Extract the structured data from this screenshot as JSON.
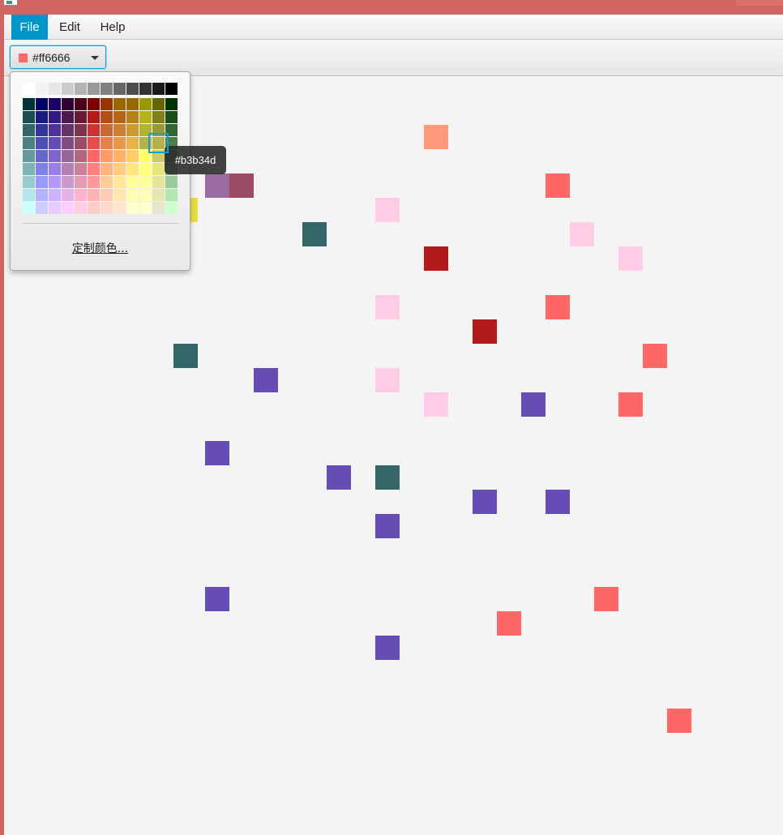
{
  "menubar": {
    "items": [
      {
        "label": "File",
        "active": true
      },
      {
        "label": "Edit",
        "active": false
      },
      {
        "label": "Help",
        "active": false
      }
    ]
  },
  "toolbar": {
    "color_picker": {
      "value": "#ff6666",
      "swatch_color": "#ff6666"
    }
  },
  "color_popup": {
    "custom_color_label": "定制颜色...",
    "tooltip": "#b3b34d",
    "selected_color": "#b3b34d",
    "palette_rows": [
      [
        "#ffffff",
        "#f2f2f2",
        "#e6e6e6",
        "#cccccc",
        "#b3b3b3",
        "#999999",
        "#808080",
        "#666666",
        "#4d4d4d",
        "#333333",
        "#1a1a1a",
        "#000000"
      ],
      [
        "#003333",
        "#000066",
        "#1a0066",
        "#330033",
        "#4d0019",
        "#800000",
        "#993300",
        "#996600",
        "#996600",
        "#999900",
        "#666600",
        "#003300"
      ],
      [
        "#1a4d4d",
        "#1a1a80",
        "#331a80",
        "#4d1a4d",
        "#661a33",
        "#b31a1a",
        "#b34d1a",
        "#b3661a",
        "#b3801a",
        "#b3b31a",
        "#80801a",
        "#1a4d1a"
      ],
      [
        "#336666",
        "#333399",
        "#4d3399",
        "#663366",
        "#80334d",
        "#cc3333",
        "#cc6633",
        "#cc8033",
        "#cc9933",
        "#b3b333",
        "#999933",
        "#336633"
      ],
      [
        "#4d8080",
        "#4d4db3",
        "#664db3",
        "#804d80",
        "#994d66",
        "#e64d4d",
        "#e6804d",
        "#e6994d",
        "#e6b34d",
        "#b3b34d",
        "#b3b34d",
        "#4d804d"
      ],
      [
        "#669999",
        "#6666cc",
        "#8066cc",
        "#996699",
        "#b36680",
        "#ff6666",
        "#ff9966",
        "#ffb366",
        "#ffcc66",
        "#ffff66",
        "#cccc66",
        "#669966"
      ],
      [
        "#80b3b3",
        "#8080e6",
        "#9980e6",
        "#b380b3",
        "#cc8099",
        "#ff8080",
        "#ffb380",
        "#ffcc80",
        "#ffe680",
        "#ffff80",
        "#e6e680",
        "#80b380"
      ],
      [
        "#99cccc",
        "#9999ff",
        "#b399ff",
        "#cc99cc",
        "#e699b3",
        "#ff9999",
        "#ffcc99",
        "#ffe699",
        "#ffff99",
        "#ffff99",
        "#e6e699",
        "#99cc99"
      ],
      [
        "#b3e6e6",
        "#b3b3ff",
        "#ccb3ff",
        "#e6b3e6",
        "#ffb3cc",
        "#ffb3b3",
        "#ffccb3",
        "#ffe6b3",
        "#ffffb3",
        "#ffffb3",
        "#e6e6b3",
        "#b3e6b3"
      ],
      [
        "#ccffff",
        "#ccccff",
        "#e6ccff",
        "#ffccff",
        "#ffcce6",
        "#ffcccc",
        "#ffd9cc",
        "#ffe6cc",
        "#ffffcc",
        "#ffffcc",
        "#e6e6cc",
        "#ccffcc"
      ]
    ]
  },
  "canvas": {
    "squares": [
      {
        "row": 0,
        "col": 1,
        "color": "#fcfc40"
      },
      {
        "row": 0,
        "col": 3,
        "color": "#1a1a66"
      },
      {
        "row": 1,
        "col": 3,
        "color": "#7a2a7a"
      },
      {
        "row": 2,
        "col": 3,
        "color": "#d8d020"
      },
      {
        "row": 2,
        "col": 1,
        "color": "#1a4d1a"
      },
      {
        "row": 2,
        "col": 17,
        "color": "#ff9a7a"
      },
      {
        "row": 4,
        "col": 8,
        "color": "#9c6aa3"
      },
      {
        "row": 4,
        "col": 9,
        "color": "#9b4b64"
      },
      {
        "row": 4,
        "col": 22,
        "color": "#ff6666"
      },
      {
        "row": 5,
        "col": 7,
        "color": "#e8e040"
      },
      {
        "row": 5,
        "col": 15,
        "color": "#ffcce6"
      },
      {
        "row": 6,
        "col": 12,
        "color": "#336666"
      },
      {
        "row": 6,
        "col": 23,
        "color": "#ffcce6"
      },
      {
        "row": 7,
        "col": 17,
        "color": "#b31a1a"
      },
      {
        "row": 7,
        "col": 25,
        "color": "#ffcce6"
      },
      {
        "row": 9,
        "col": 15,
        "color": "#ffcce6"
      },
      {
        "row": 9,
        "col": 22,
        "color": "#ff6666"
      },
      {
        "row": 10,
        "col": 19,
        "color": "#b31a1a"
      },
      {
        "row": 11,
        "col": 7,
        "color": "#336666"
      },
      {
        "row": 11,
        "col": 26,
        "color": "#ff6666"
      },
      {
        "row": 12,
        "col": 10,
        "color": "#664db3"
      },
      {
        "row": 12,
        "col": 15,
        "color": "#ffcce6"
      },
      {
        "row": 13,
        "col": 17,
        "color": "#ffcce6"
      },
      {
        "row": 13,
        "col": 21,
        "color": "#664db3"
      },
      {
        "row": 13,
        "col": 25,
        "color": "#ff6666"
      },
      {
        "row": 15,
        "col": 8,
        "color": "#664db3"
      },
      {
        "row": 16,
        "col": 13,
        "color": "#664db3"
      },
      {
        "row": 16,
        "col": 15,
        "color": "#336666"
      },
      {
        "row": 17,
        "col": 19,
        "color": "#664db3"
      },
      {
        "row": 17,
        "col": 22,
        "color": "#664db3"
      },
      {
        "row": 18,
        "col": 15,
        "color": "#664db3"
      },
      {
        "row": 21,
        "col": 8,
        "color": "#664db3"
      },
      {
        "row": 21,
        "col": 24,
        "color": "#ff6666"
      },
      {
        "row": 22,
        "col": 20,
        "color": "#ff6666"
      },
      {
        "row": 23,
        "col": 15,
        "color": "#664db3"
      },
      {
        "row": 26,
        "col": 27,
        "color": "#ff6666"
      }
    ]
  }
}
